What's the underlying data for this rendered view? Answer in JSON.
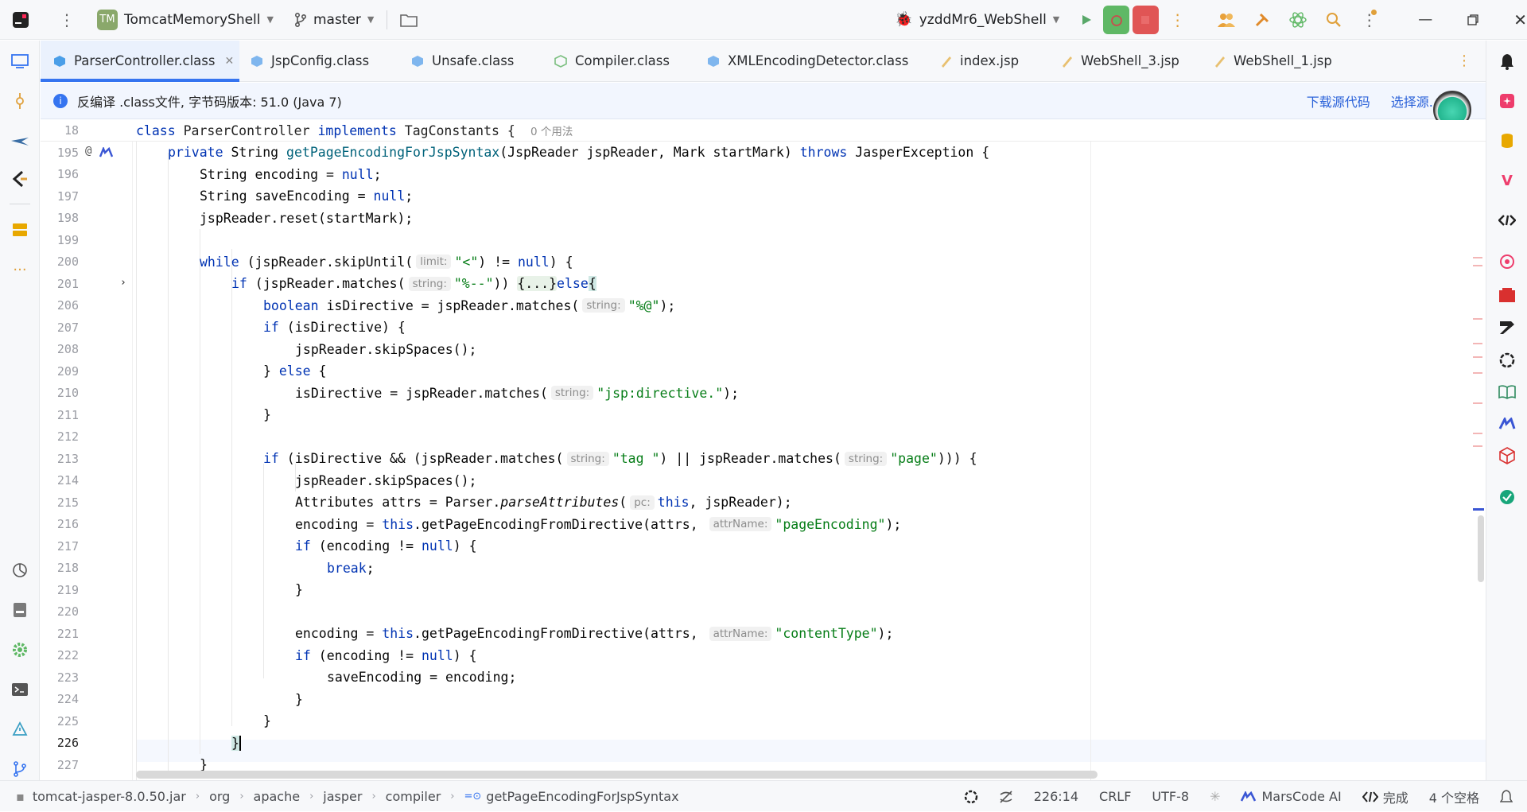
{
  "titlebar": {
    "project_badge": "TM",
    "project_name": "TomcatMemoryShell",
    "branch": "master",
    "run_config": "yzddMr6_WebShell"
  },
  "tabs": [
    {
      "label": "ParserController.class",
      "active": true,
      "icon": "class-file-icon"
    },
    {
      "label": "JspConfig.class",
      "icon": "class-file-icon"
    },
    {
      "label": "Unsafe.class",
      "icon": "class-file-icon"
    },
    {
      "label": "Compiler.class",
      "icon": "class-file-icon"
    },
    {
      "label": "XMLEncodingDetector.class",
      "icon": "class-file-icon"
    },
    {
      "label": "index.jsp",
      "icon": "jsp-file-icon"
    },
    {
      "label": "WebShell_3.jsp",
      "icon": "jsp-file-icon"
    },
    {
      "label": "WebShell_1.jsp",
      "icon": "jsp-file-icon"
    }
  ],
  "banner": {
    "text": "反编译 .class文件, 字节码版本: 51.0 (Java 7)",
    "download_link": "下载源代码",
    "choose_link": "选择源..."
  },
  "sticky": {
    "line_no": "18",
    "usages": "0 个用法"
  },
  "line_numbers": [
    "195",
    "196",
    "197",
    "198",
    "199",
    "200",
    "201",
    "206",
    "207",
    "208",
    "209",
    "210",
    "211",
    "212",
    "213",
    "214",
    "215",
    "216",
    "217",
    "218",
    "219",
    "220",
    "221",
    "222",
    "223",
    "224",
    "225",
    "226",
    "227"
  ],
  "hints": {
    "limit": "limit:",
    "string": "string:",
    "pc": "pc:",
    "attrName": "attrName:"
  },
  "status": {
    "breadcrumb": [
      "tomcat-jasper-8.0.50.jar",
      "org",
      "apache",
      "jasper",
      "compiler",
      "getPageEncodingForJspSyntax"
    ],
    "position": "226:14",
    "line_sep": "CRLF",
    "encoding": "UTF-8",
    "ai": "MarsCode AI",
    "done": "完成",
    "indent": "4 个空格"
  },
  "colors": {
    "accent": "#3574f0",
    "keyword": "#0033b3",
    "string": "#067d17",
    "method": "#00627a"
  }
}
